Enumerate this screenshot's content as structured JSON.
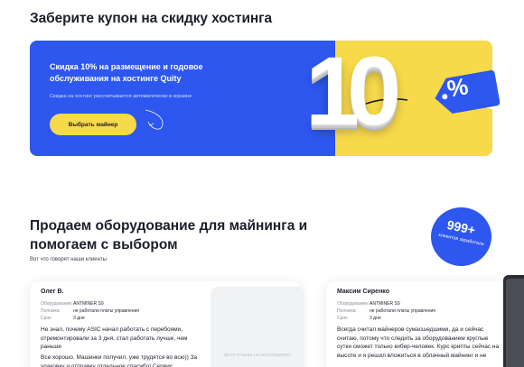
{
  "coupon_section": {
    "title": "Заберите купон на скидку хостинга",
    "headline": "Скидка 10% на размещение и годовое обслуживания на хостинге Quity",
    "note": "Скидка на хостинг рассчитывается автоматически в корзине",
    "button_label": "Выбрать майнер",
    "big_number": "10",
    "tag_label": "%",
    "colors": {
      "card_blue": "#2d57ee",
      "card_yellow": "#f7d94a",
      "tag_blue": "#2d57ee"
    }
  },
  "mining_section": {
    "title": "Продаем оборудование для майнинга и помогаем с выбором",
    "subtitle": "Вот что говорят наши клиенты",
    "badge": {
      "number": "999+",
      "text": "клиентов заработали"
    }
  },
  "reviews": [
    {
      "name": "Олег В.",
      "meta": [
        {
          "key": "Оборудование:",
          "value": "ANTMINER S9"
        },
        {
          "key": "Поломка:",
          "value": "не работали платы управления"
        },
        {
          "key": "Срок:",
          "value": "3 дня"
        }
      ],
      "text_1": "Не знал, почему ASIC начал работать с перебоями, отремонтировали за 3 дня, стал работать лучше, чем раньше",
      "text_2": "Все хорошо. Машинки получил, уже трудятся во всю)) За упаковку и отправку отдельное спасибо! Сервис",
      "photo_text": "фото отзыва на мессенджере"
    },
    {
      "name": "Максим Сиренко",
      "meta": [
        {
          "key": "Оборудование:",
          "value": "ANTMINER S9"
        },
        {
          "key": "Поломка:",
          "value": "не работали платы управления"
        },
        {
          "key": "Срок:",
          "value": "3 дня"
        }
      ],
      "text_1": "Всегда считал майнеров сумасшедшими, да и сейчас считаю, потому что следить за оборудованием круглые сутки сможет только кибер-человек. Курс крипты сейчас на высоте и я решил вложиться в облачный майнинг и не"
    }
  ]
}
